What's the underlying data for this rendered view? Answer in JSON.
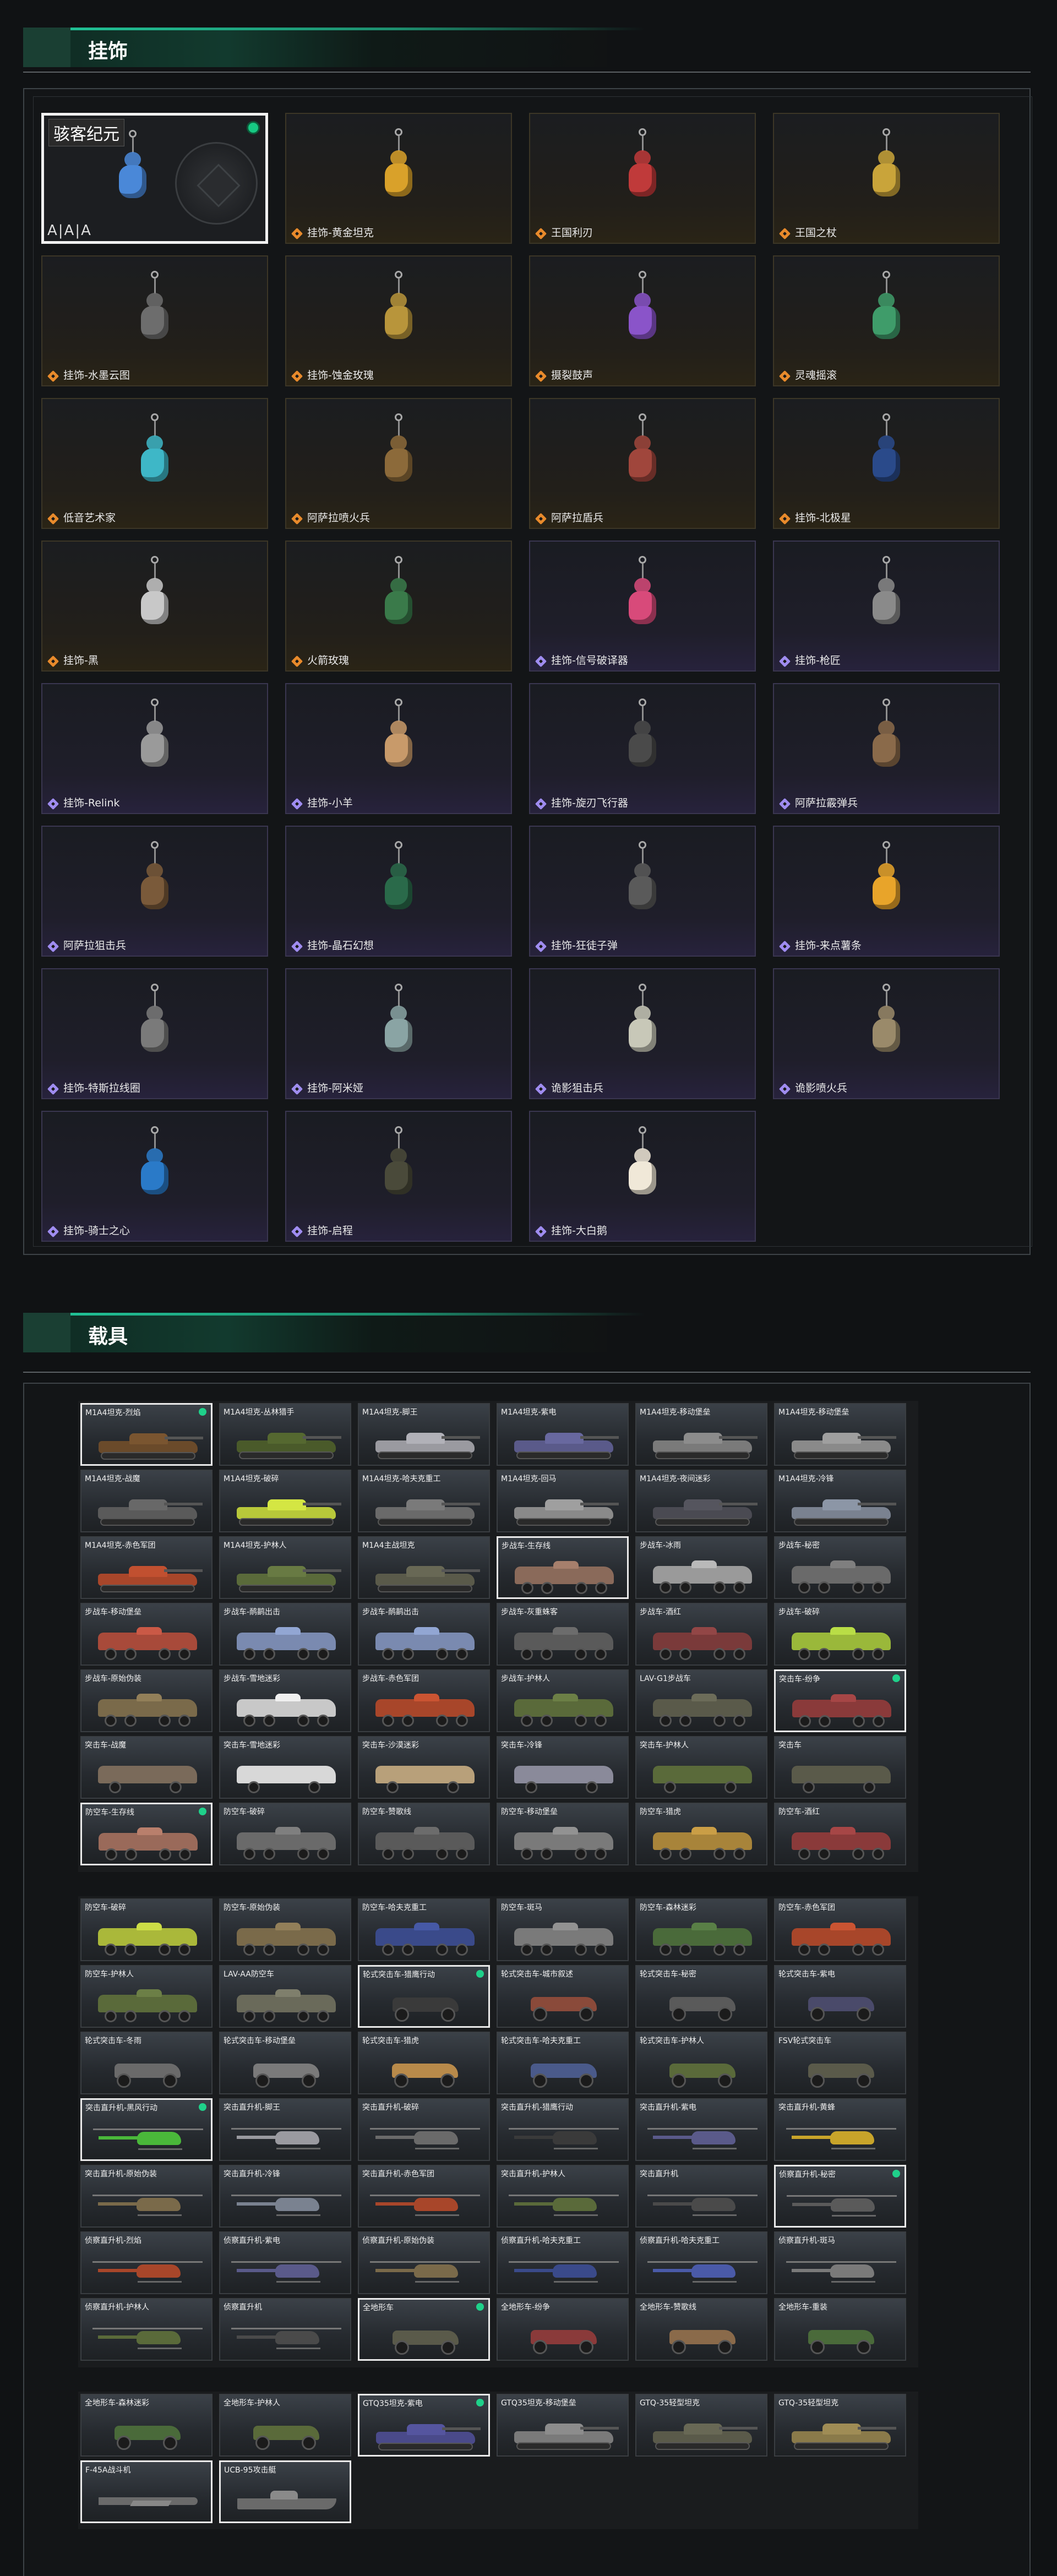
{
  "sections": {
    "charms_title": "挂饰",
    "vehicles_title": "载具"
  },
  "charms": [
    {
      "label": "",
      "rarity": "gold",
      "color": "#4a88d8",
      "selected": true,
      "badge": "骇客纪元",
      "footer": "A|A|A"
    },
    {
      "label": "挂饰-黄金坦克",
      "rarity": "gold",
      "color": "#d9a12a"
    },
    {
      "label": "王国利刃",
      "rarity": "gold",
      "color": "#c03a3a"
    },
    {
      "label": "王国之杖",
      "rarity": "gold",
      "color": "#c9a43a"
    },
    {
      "label": "挂饰-水墨云图",
      "rarity": "gold",
      "color": "#6d6d6d"
    },
    {
      "label": "挂饰-蚀金玫瑰",
      "rarity": "gold",
      "color": "#b8953b"
    },
    {
      "label": "摄裂鼓声",
      "rarity": "gold",
      "color": "#8a54c9"
    },
    {
      "label": "灵魂摇滚",
      "rarity": "gold",
      "color": "#3f9c6a"
    },
    {
      "label": "低音艺术家",
      "rarity": "gold",
      "color": "#3eb7c7"
    },
    {
      "label": "阿萨拉喷火兵",
      "rarity": "gold",
      "color": "#8c6a3a"
    },
    {
      "label": "阿萨拉盾兵",
      "rarity": "gold",
      "color": "#a0463c"
    },
    {
      "label": "挂饰-北极星",
      "rarity": "gold",
      "color": "#2a4a8a"
    },
    {
      "label": "挂饰-黑",
      "rarity": "gold",
      "color": "#c8c8c8"
    },
    {
      "label": "火箭玫瑰",
      "rarity": "gold",
      "color": "#3a7a4a"
    },
    {
      "label": "挂饰-信号破译器",
      "rarity": "violet",
      "color": "#d84a7a"
    },
    {
      "label": "挂饰-枪匠",
      "rarity": "violet",
      "color": "#8a8a8a"
    },
    {
      "label": "挂饰-Relink",
      "rarity": "violet",
      "color": "#9a9a9a"
    },
    {
      "label": "挂饰-小羊",
      "rarity": "violet",
      "color": "#c89a6a"
    },
    {
      "label": "挂饰-旋刃飞行器",
      "rarity": "violet",
      "color": "#4a4a4a"
    },
    {
      "label": "阿萨拉霰弹兵",
      "rarity": "violet",
      "color": "#8a6a4a"
    },
    {
      "label": "阿萨拉狙击兵",
      "rarity": "violet",
      "color": "#7a5a3a"
    },
    {
      "label": "挂饰-晶石幻想",
      "rarity": "violet",
      "color": "#2a6a4a"
    },
    {
      "label": "挂饰-狂徒子弹",
      "rarity": "violet",
      "color": "#5a5a5a"
    },
    {
      "label": "挂饰-来点薯条",
      "rarity": "violet",
      "color": "#e8a42a"
    },
    {
      "label": "挂饰-特斯拉线圈",
      "rarity": "violet",
      "color": "#7a7a7a"
    },
    {
      "label": "挂饰-阿米娅",
      "rarity": "violet",
      "color": "#8aa4a4"
    },
    {
      "label": "诡影狙击兵",
      "rarity": "violet",
      "color": "#c8c8b8"
    },
    {
      "label": "诡影喷火兵",
      "rarity": "violet",
      "color": "#9a8a6a"
    },
    {
      "label": "挂饰-骑士之心",
      "rarity": "violet",
      "color": "#2a7ac8"
    },
    {
      "label": "挂饰-启程",
      "rarity": "violet",
      "color": "#4a4a3a"
    },
    {
      "label": "挂饰-大白鹅",
      "rarity": "violet",
      "color": "#f0e8d8"
    }
  ],
  "vehicles_group1": [
    {
      "label": "M1A4坦克-烈焰",
      "type": "tank",
      "color": "#6a4a2a",
      "sel": true,
      "dot": true
    },
    {
      "label": "M1A4坦克-丛林猎手",
      "type": "tank",
      "color": "#4a5a2a"
    },
    {
      "label": "M1A4坦克-脚王",
      "type": "tank",
      "color": "#9a9aa0"
    },
    {
      "label": "M1A4坦克-紫电",
      "type": "tank",
      "color": "#5a5a8a"
    },
    {
      "label": "M1A4坦克-移动堡垒",
      "type": "tank",
      "color": "#7a7a7a"
    },
    {
      "label": "M1A4坦克-移动堡垒",
      "type": "tank",
      "color": "#8a8a8a"
    },
    {
      "label": "M1A4坦克-战魔",
      "type": "tank",
      "color": "#5a5a5a"
    },
    {
      "label": "M1A4坦克-破碎",
      "type": "tank",
      "color": "#b8c83a"
    },
    {
      "label": "M1A4坦克-哈夫克重工",
      "type": "tank",
      "color": "#6a6a6a"
    },
    {
      "label": "M1A4坦克-回马",
      "type": "tank",
      "color": "#8a8a8a"
    },
    {
      "label": "M1A4坦克-夜间迷彩",
      "type": "tank",
      "color": "#4a4a52"
    },
    {
      "label": "M1A4坦克-冷锋",
      "type": "tank",
      "color": "#7a8290"
    },
    {
      "label": "M1A4坦克-赤色军团",
      "type": "tank",
      "color": "#a8462a"
    },
    {
      "label": "M1A4坦克-护林人",
      "type": "tank",
      "color": "#5a6a3a"
    },
    {
      "label": "M1A4主战坦克",
      "type": "tank",
      "color": "#5a5a4a"
    },
    {
      "label": "步战车-生存线",
      "type": "ifv",
      "color": "#8a6a5a",
      "sel": true
    },
    {
      "label": "步战车-冰雨",
      "type": "ifv",
      "color": "#9a9a9a"
    },
    {
      "label": "步战车-秘密",
      "type": "ifv",
      "color": "#6a6a6a"
    },
    {
      "label": "步战车-移动堡垒",
      "type": "ifv",
      "color": "#a84a3a"
    },
    {
      "label": "步战车-鸸鹋出击",
      "type": "ifv",
      "color": "#7a8ab0"
    },
    {
      "label": "步战车-鸸鹋出击",
      "type": "ifv",
      "color": "#7a8ab0"
    },
    {
      "label": "步战车-灰重蛛客",
      "type": "ifv",
      "color": "#5a5a5a"
    },
    {
      "label": "步战车-酒红",
      "type": "ifv",
      "color": "#7a3a3a"
    },
    {
      "label": "步战车-破碎",
      "type": "ifv",
      "color": "#9ab83a"
    },
    {
      "label": "步战车-原始伪装",
      "type": "ifv",
      "color": "#7a6a4a"
    },
    {
      "label": "步战车-雪地迷彩",
      "type": "ifv",
      "color": "#c8c8c8"
    },
    {
      "label": "步战车-赤色军团",
      "type": "ifv",
      "color": "#a8462a"
    },
    {
      "label": "步战车-护林人",
      "type": "ifv",
      "color": "#5a6a3a"
    },
    {
      "label": "LAV-G1步战车",
      "type": "ifv",
      "color": "#5a5a4a"
    },
    {
      "label": "突击车-纷争",
      "type": "ifv",
      "color": "#8a3a3a",
      "sel": true,
      "dot": true
    },
    {
      "label": "突击车-战魔",
      "type": "truck",
      "color": "#7a6a5a"
    },
    {
      "label": "突击车-雪地迷彩",
      "type": "truck",
      "color": "#d8d8d8"
    },
    {
      "label": "突击车-沙漠迷彩",
      "type": "truck",
      "color": "#b8a07a"
    },
    {
      "label": "突击车-冷锋",
      "type": "truck",
      "color": "#8a8a9a"
    },
    {
      "label": "突击车-护林人",
      "type": "truck",
      "color": "#5a6a3a"
    },
    {
      "label": "突击车",
      "type": "truck",
      "color": "#5a5a4a"
    },
    {
      "label": "防空车-生存线",
      "type": "ifv",
      "color": "#9a6a5a",
      "sel": true,
      "dot": true
    },
    {
      "label": "防空车-破碎",
      "type": "ifv",
      "color": "#6a6a6a"
    },
    {
      "label": "防空车-赞歌线",
      "type": "ifv",
      "color": "#5a5a5a"
    },
    {
      "label": "防空车-移动堡垒",
      "type": "ifv",
      "color": "#7a7a7a"
    },
    {
      "label": "防空车-猎虎",
      "type": "ifv",
      "color": "#a8843a"
    },
    {
      "label": "防空车-酒红",
      "type": "ifv",
      "color": "#8a3a3a"
    }
  ],
  "vehicles_group2": [
    {
      "label": "防空车-破碎",
      "type": "ifv",
      "color": "#aab83a"
    },
    {
      "label": "防空车-原始伪装",
      "type": "ifv",
      "color": "#7a6a4a"
    },
    {
      "label": "防空车-哈夫克重工",
      "type": "ifv",
      "color": "#3a4a8a"
    },
    {
      "label": "防空车-斑马",
      "type": "ifv",
      "color": "#7a7a7a"
    },
    {
      "label": "防空车-森林迷彩",
      "type": "ifv",
      "color": "#4a6a3a"
    },
    {
      "label": "防空车-赤色军团",
      "type": "ifv",
      "color": "#a8462a"
    },
    {
      "label": "防空车-护林人",
      "type": "ifv",
      "color": "#5a6a3a"
    },
    {
      "label": "LAV-AA防空车",
      "type": "ifv",
      "color": "#6a6a5a"
    },
    {
      "label": "轮式突击车-猎鹰行动",
      "type": "buggy",
      "color": "#3a3a3a",
      "sel": true,
      "dot": true
    },
    {
      "label": "轮式突击车-城市叙述",
      "type": "buggy",
      "color": "#8a4a3a"
    },
    {
      "label": "轮式突击车-秘密",
      "type": "buggy",
      "color": "#5a5a5a"
    },
    {
      "label": "轮式突击车-紫电",
      "type": "buggy",
      "color": "#4a4a6a"
    },
    {
      "label": "轮式突击车-冬雨",
      "type": "buggy",
      "color": "#6a6a6a"
    },
    {
      "label": "轮式突击车-移动堡垒",
      "type": "buggy",
      "color": "#7a7a7a"
    },
    {
      "label": "轮式突击车-猎虎",
      "type": "buggy",
      "color": "#b88a4a"
    },
    {
      "label": "轮式突击车-哈夫克重工",
      "type": "buggy",
      "color": "#4a5a8a"
    },
    {
      "label": "轮式突击车-护林人",
      "type": "buggy",
      "color": "#5a6a3a"
    },
    {
      "label": "FSV轮式突击车",
      "type": "buggy",
      "color": "#5a5a4a"
    },
    {
      "label": "突击直升机-黑风行动",
      "type": "heli",
      "color": "#4ab83a",
      "sel": true,
      "dot": true
    },
    {
      "label": "突击直升机-脚王",
      "type": "heli",
      "color": "#9a9aa0"
    },
    {
      "label": "突击直升机-破碎",
      "type": "heli",
      "color": "#6a6a6a"
    },
    {
      "label": "突击直升机-猎鹰行动",
      "type": "heli",
      "color": "#3a3a3a"
    },
    {
      "label": "突击直升机-紫电",
      "type": "heli",
      "color": "#5a5a8a"
    },
    {
      "label": "突击直升机-黄蜂",
      "type": "heli",
      "color": "#c8a42a"
    },
    {
      "label": "突击直升机-原始伪装",
      "type": "heli",
      "color": "#7a6a4a"
    },
    {
      "label": "突击直升机-冷锋",
      "type": "heli",
      "color": "#7a8290"
    },
    {
      "label": "突击直升机-赤色军团",
      "type": "heli",
      "color": "#a8462a"
    },
    {
      "label": "突击直升机-护林人",
      "type": "heli",
      "color": "#5a6a3a"
    },
    {
      "label": "突击直升机",
      "type": "heli",
      "color": "#4a4a4a"
    },
    {
      "label": "侦察直升机-秘密",
      "type": "heli",
      "color": "#5a5a5a",
      "sel": true,
      "dot": true
    },
    {
      "label": "侦察直升机-烈焰",
      "type": "heli",
      "color": "#a8462a"
    },
    {
      "label": "侦察直升机-紫电",
      "type": "heli",
      "color": "#5a5a8a"
    },
    {
      "label": "侦察直升机-原始伪装",
      "type": "heli",
      "color": "#7a6a4a"
    },
    {
      "label": "侦察直升机-哈夫克重工",
      "type": "heli",
      "color": "#3a4a8a"
    },
    {
      "label": "侦察直升机-哈夫克重工",
      "type": "heli",
      "color": "#4a5aa8"
    },
    {
      "label": "侦察直升机-斑马",
      "type": "heli",
      "color": "#7a7a7a"
    },
    {
      "label": "侦察直升机-护林人",
      "type": "heli",
      "color": "#5a6a3a"
    },
    {
      "label": "侦察直升机",
      "type": "heli",
      "color": "#4a4a4a"
    },
    {
      "label": "全地形车",
      "type": "atv",
      "color": "#5a5a4a",
      "sel": true,
      "dot": true
    },
    {
      "label": "全地形车-纷争",
      "type": "atv",
      "color": "#8a3a3a"
    },
    {
      "label": "全地形车-赞歌线",
      "type": "atv",
      "color": "#8a6a4a"
    },
    {
      "label": "全地形车-重装",
      "type": "atv",
      "color": "#4a6a3a"
    }
  ],
  "vehicles_group3": [
    {
      "label": "全地形车-森林迷彩",
      "type": "atv",
      "color": "#4a6a3a"
    },
    {
      "label": "全地形车-护林人",
      "type": "atv",
      "color": "#5a6a3a"
    },
    {
      "label": "GTQ35坦克-紫电",
      "type": "tank",
      "color": "#4a4a8a",
      "sel": true,
      "dot": true
    },
    {
      "label": "GTQ35坦克-移动堡垒",
      "type": "tank",
      "color": "#7a7a7a"
    },
    {
      "label": "GTQ-35轻型坦克",
      "type": "tank",
      "color": "#5a5a4a"
    },
    {
      "label": "GTQ-35轻型坦克",
      "type": "tank",
      "color": "#8a7a4a"
    },
    {
      "label": "F-45A战斗机",
      "type": "jet",
      "color": "#6a6a6a",
      "sel": true
    },
    {
      "label": "UCB-95攻击艇",
      "type": "boat",
      "color": "#6a6a6a",
      "sel": true
    }
  ]
}
